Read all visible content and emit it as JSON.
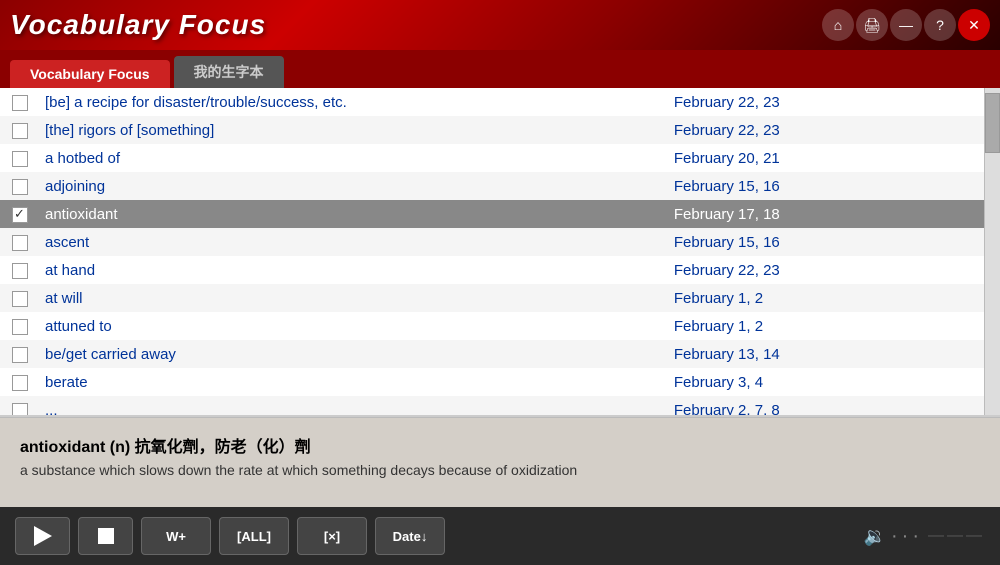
{
  "titleBar": {
    "title": "Vocabulary Focus",
    "controls": [
      "home",
      "print",
      "minimize",
      "help",
      "close"
    ]
  },
  "tabs": [
    {
      "label": "Vocabulary Focus",
      "active": true
    },
    {
      "label": "我的生字本",
      "active": false
    }
  ],
  "vocabList": {
    "items": [
      {
        "id": 1,
        "checked": false,
        "word": "[be] a recipe for disaster/trouble/success, etc.",
        "date": "February 22, 23",
        "selected": false
      },
      {
        "id": 2,
        "checked": false,
        "word": "[the] rigors of [something]",
        "date": "February 22, 23",
        "selected": false
      },
      {
        "id": 3,
        "checked": false,
        "word": "a hotbed of",
        "date": "February 20, 21",
        "selected": false
      },
      {
        "id": 4,
        "checked": false,
        "word": "adjoining",
        "date": "February 15, 16",
        "selected": false
      },
      {
        "id": 5,
        "checked": true,
        "word": "antioxidant",
        "date": "February 17, 18",
        "selected": true
      },
      {
        "id": 6,
        "checked": false,
        "word": "ascent",
        "date": "February 15, 16",
        "selected": false
      },
      {
        "id": 7,
        "checked": false,
        "word": "at hand",
        "date": "February 22, 23",
        "selected": false
      },
      {
        "id": 8,
        "checked": false,
        "word": "at will",
        "date": "February 1, 2",
        "selected": false
      },
      {
        "id": 9,
        "checked": false,
        "word": "attuned to",
        "date": "February 1, 2",
        "selected": false
      },
      {
        "id": 10,
        "checked": false,
        "word": "be/get carried away",
        "date": "February 13, 14",
        "selected": false
      },
      {
        "id": 11,
        "checked": false,
        "word": "berate",
        "date": "February 3, 4",
        "selected": false
      },
      {
        "id": 12,
        "checked": false,
        "word": "...",
        "date": "February 2, 7, 8",
        "selected": false
      }
    ]
  },
  "definition": {
    "word": "antioxidant",
    "partOfSpeech": "(n)",
    "chineseTranslation": "抗氧化劑，防老（化）劑",
    "englishDef": "a substance which slows down the rate at which something decays because of  oxidization"
  },
  "bottomBar": {
    "playLabel": "▶",
    "stopLabel": "■",
    "addWordLabel": "W+",
    "selectAllLabel": "[ALL]",
    "clearLabel": "[×]",
    "sortLabel": "Date↓"
  }
}
